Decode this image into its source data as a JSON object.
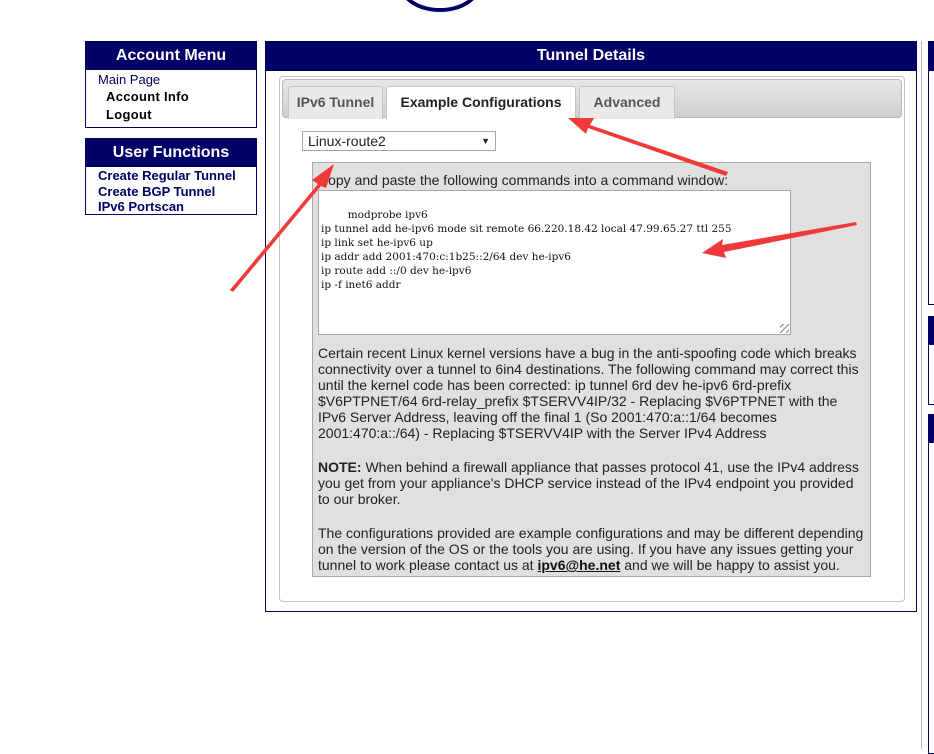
{
  "account_menu": {
    "title": "Account Menu",
    "items": [
      {
        "label": "Main Page"
      },
      {
        "label": "Account Info"
      },
      {
        "label": "Logout"
      }
    ]
  },
  "user_functions": {
    "title": "User Functions",
    "items": [
      {
        "label": "Create Regular Tunnel"
      },
      {
        "label": "Create BGP Tunnel"
      },
      {
        "label": "IPv6 Portscan"
      }
    ]
  },
  "tunnel_details": {
    "title": "Tunnel Details",
    "tabs": [
      {
        "label": "IPv6 Tunnel",
        "active": false
      },
      {
        "label": "Example Configurations",
        "active": true
      },
      {
        "label": "Advanced",
        "active": false
      }
    ],
    "os_select": {
      "value": "Linux-route2"
    },
    "instructions": "Copy and paste the following commands into a command window:",
    "commands": "modprobe ipv6\nip tunnel add he-ipv6 mode sit remote 66.220.18.42 local 47.99.65.27 ttl 255\nip link set he-ipv6 up\nip addr add 2001:470:c:1b25::2/64 dev he-ipv6\nip route add ::/0 dev he-ipv6\nip -f inet6 addr",
    "bug_note": "Certain recent Linux kernel versions have a bug in the anti-spoofing code which breaks connectivity over a tunnel to 6in4 destinations. The following command may correct this until the kernel code has been corrected: ip tunnel 6rd dev he-ipv6 6rd-prefix $V6PTPNET/64 6rd-relay_prefix $TSERVV4IP/32 - Replacing $V6PTPNET with the IPv6 Server Address, leaving off the final 1 (So 2001:470:a::1/64 becomes 2001:470:a::/64) - Replacing $TSERVV4IP with the Server IPv4 Address",
    "note_label": "NOTE:",
    "note_text": " When behind a firewall appliance that passes protocol 41, use the IPv4 address you get from your appliance's DHCP service instead of the IPv4 endpoint you provided to our broker.",
    "disclaimer_before": "The configurations provided are example configurations and may be different depending on the version of the OS or the tools you are using. If you have any issues getting your tunnel to work please contact us at ",
    "contact_email": "ipv6@he.net",
    "disclaimer_after": " and we will be happy to assist you."
  },
  "colors": {
    "header_bg": "#000066",
    "panel_bg": "#e0e0e0",
    "annotation_arrow": "#f03a3a"
  }
}
